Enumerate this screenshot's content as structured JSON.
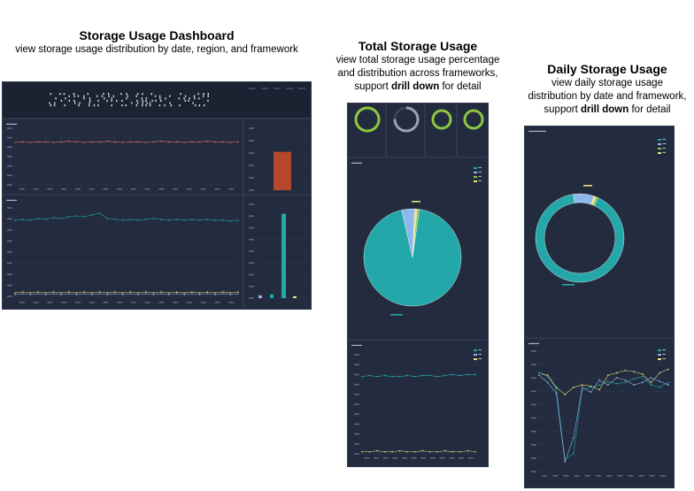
{
  "captions": {
    "dashboard": {
      "title": "Storage Usage Dashboard",
      "subtitle": "view storage usage distribution by date, region, and framework"
    },
    "total": {
      "title": "Total Storage Usage",
      "line1": "view total storage usage percentage",
      "line2": "and distribution across frameworks,",
      "line3_pre": "support ",
      "line3_bold": "drill down",
      "line3_post": " for detail"
    },
    "daily": {
      "title": "Daily Storage Usage",
      "line1": "view daily storage usage",
      "line2": "distribution by date and framework,",
      "line3_pre": "support ",
      "line3_bold": "drill down",
      "line3_post": " for detail"
    }
  },
  "colors": {
    "panel_bg": "#1f2638",
    "card_bg": "#232b3f",
    "teal": "#23a7a8",
    "blue_light": "#8fb7ef",
    "yellow": "#e8e27a",
    "green_ring": "#8cc63e",
    "red_bar": "#b5472f",
    "line_red": "#d9725a"
  },
  "dashboard": {
    "banner_icon": "pixel-art-banner",
    "charts": {
      "daily_red": {
        "type": "line",
        "values": [
          75,
          76,
          75,
          76,
          76,
          75,
          76,
          77,
          76,
          75,
          76,
          76,
          77,
          76,
          75,
          76,
          76,
          75,
          76,
          77,
          76,
          76,
          75,
          76,
          76,
          77,
          76,
          76,
          75,
          76
        ]
      },
      "daily_teal": {
        "type": "line",
        "series": [
          {
            "name": "",
            "values": [
              86,
              87,
              86,
              88,
              87,
              89,
              88,
              90,
              91,
              90,
              92,
              94,
              88,
              87,
              86,
              87,
              86,
              87,
              88,
              87,
              86,
              87,
              86,
              87,
              86,
              87,
              86,
              86,
              85,
              86
            ]
          },
          {
            "name": "",
            "values": [
              4,
              5,
              4,
              5,
              4,
              5,
              4,
              5,
              4,
              5,
              4,
              5,
              4,
              5,
              4,
              5,
              4,
              5,
              4,
              5,
              4,
              5,
              4,
              5,
              4,
              5,
              4,
              5,
              4,
              5
            ]
          },
          {
            "name": "",
            "values": [
              2,
              3,
              2,
              3,
              2,
              3,
              2,
              3,
              2,
              3,
              2,
              3,
              2,
              3,
              2,
              3,
              2,
              3,
              2,
              3,
              2,
              3,
              2,
              3,
              2,
              3,
              2,
              3,
              2,
              3
            ]
          }
        ]
      },
      "side_red_bar": {
        "type": "bar",
        "values": [
          62
        ]
      },
      "side_teal_bars": {
        "type": "bar",
        "values": [
          3,
          4,
          90,
          2
        ]
      }
    }
  },
  "total_view": {
    "gauges": [
      {
        "icon": "ring-gauge",
        "fraction": 1.0
      },
      {
        "icon": "ring-gauge",
        "fraction": 0.75
      },
      {
        "icon": "ring-gauge",
        "fraction": 1.0
      },
      {
        "icon": "ring-gauge",
        "fraction": 1.0
      }
    ],
    "pie": {
      "type": "pie",
      "slices": [
        {
          "name": "",
          "value": 94.2,
          "color": "#23a7a8"
        },
        {
          "name": "",
          "value": 4.3,
          "color": "#8fb7ef"
        },
        {
          "name": "",
          "value": 0.8,
          "color": "#e8e27a"
        },
        {
          "name": "",
          "value": 0.7,
          "color": "#8cc63e"
        }
      ]
    },
    "line": {
      "type": "line",
      "series": [
        {
          "name": "",
          "values": [
            78,
            79,
            78,
            79,
            78,
            78,
            79,
            78,
            79,
            79,
            78,
            79,
            80,
            79,
            80,
            80
          ]
        },
        {
          "name": "",
          "values": [
            2,
            2,
            3,
            2,
            2,
            3,
            2,
            2,
            3,
            2,
            2,
            3,
            2,
            2,
            3,
            2
          ]
        }
      ]
    }
  },
  "daily_view": {
    "donut": {
      "type": "pie",
      "slices": [
        {
          "name": "",
          "value": 91.0,
          "color": "#23a7a8"
        },
        {
          "name": "",
          "value": 7.5,
          "color": "#8fb7ef"
        },
        {
          "name": "",
          "value": 0.8,
          "color": "#e8e27a"
        },
        {
          "name": "",
          "value": 0.7,
          "color": "#8cc63e"
        }
      ]
    },
    "line": {
      "type": "line",
      "series": [
        {
          "name": "",
          "values": [
            82,
            80,
            70,
            64,
            70,
            72,
            71,
            68,
            80,
            82,
            84,
            83,
            81,
            74,
            82,
            85
          ]
        },
        {
          "name": "",
          "values": [
            82,
            79,
            69,
            10,
            15,
            68,
            70,
            72,
            75,
            73,
            74,
            77,
            79,
            72,
            70,
            74
          ]
        },
        {
          "name": "",
          "values": [
            80,
            74,
            65,
            8,
            28,
            70,
            66,
            76,
            72,
            78,
            76,
            72,
            74,
            78,
            75,
            72
          ]
        }
      ]
    }
  }
}
